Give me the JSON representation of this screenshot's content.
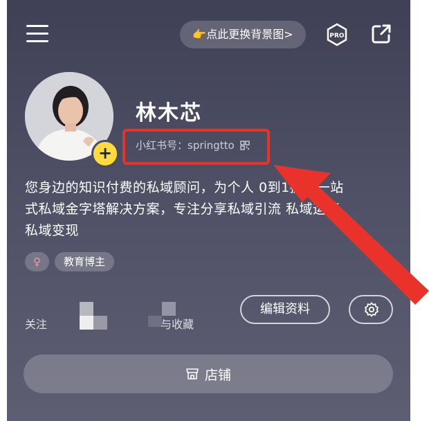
{
  "header": {
    "change_background_label": "👉点此更换背景图>",
    "pro_badge": "PRO",
    "menu_icon": "hamburger-icon",
    "share_icon": "share-icon"
  },
  "profile": {
    "name": "林木芯",
    "id_label": "小红书号：springtto",
    "bio_lines": [
      "您身边的知识付费的私域顾问，为个人   0到1提供一站",
      "式私域金字塔解决方案，专注分享私域引流 私域运营，",
      "私域变现"
    ],
    "gender_symbol": "♀",
    "tags": [
      "教育博主"
    ],
    "add_symbol": "+"
  },
  "stats": {
    "left_label": "关注",
    "right_label": "与收藏"
  },
  "actions": {
    "edit_profile": "编辑资料",
    "shop": "店铺"
  },
  "colors": {
    "highlight": "#e8322a",
    "add_badge": "#ffdc3e",
    "gender": "#ff8fa3"
  }
}
